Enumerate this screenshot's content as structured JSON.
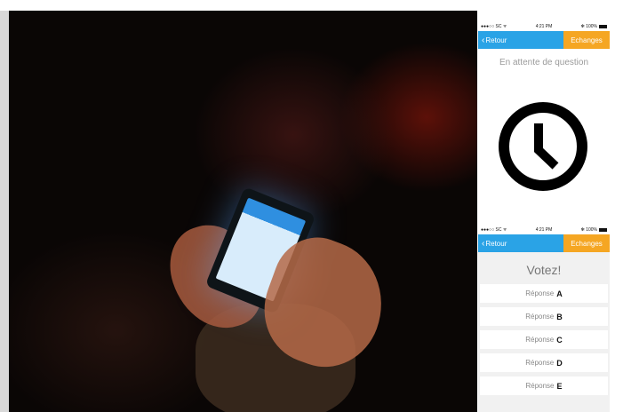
{
  "mock1": {
    "status": {
      "carrier": "●●●○○ SC  ᯤ",
      "time": "4:21 PM",
      "battery": "✻ 100%"
    },
    "nav": {
      "back_label": "Retour",
      "right_label": "Echanges"
    },
    "waiting_text": "En attente de question"
  },
  "mock2": {
    "status": {
      "carrier": "●●●○○ SC  ᯤ",
      "time": "4:21 PM",
      "battery": "✻ 100%"
    },
    "nav": {
      "back_label": "Retour",
      "right_label": "Echanges"
    },
    "vote_title": "Votez!",
    "answers": [
      {
        "label": "Réponse",
        "letter": "A"
      },
      {
        "label": "Réponse",
        "letter": "B"
      },
      {
        "label": "Réponse",
        "letter": "C"
      },
      {
        "label": "Réponse",
        "letter": "D"
      },
      {
        "label": "Réponse",
        "letter": "E"
      }
    ]
  },
  "colors": {
    "nav_blue": "#2aa3e6",
    "nav_orange": "#f5a623"
  },
  "icons": {
    "back": "chevron-left-icon",
    "clock": "clock-icon"
  }
}
